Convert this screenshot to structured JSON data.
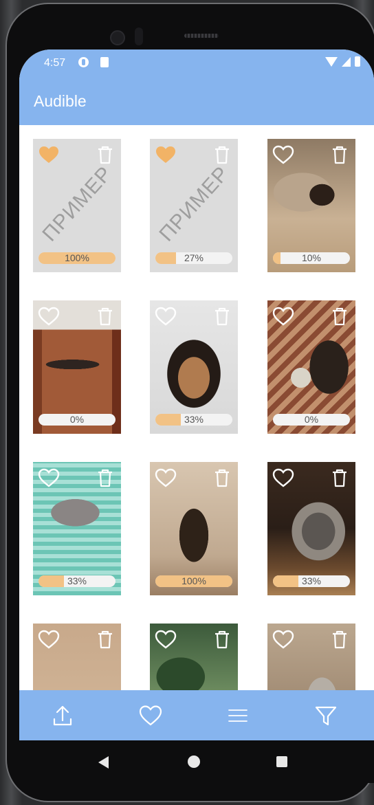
{
  "status": {
    "time": "4:57"
  },
  "app": {
    "title": "Audible"
  },
  "items": [
    {
      "placeholder": true,
      "watermark": "ПРИМЕР",
      "favorite": true,
      "progress": 100,
      "progress_label": "100%"
    },
    {
      "placeholder": true,
      "watermark": "ПРИМЕР",
      "favorite": true,
      "progress": 27,
      "progress_label": "27%"
    },
    {
      "placeholder": false,
      "favorite": false,
      "progress": 10,
      "progress_label": "10%",
      "photo": "dog-on-knitted-blanket"
    },
    {
      "placeholder": false,
      "favorite": false,
      "progress": 0,
      "progress_label": "0%",
      "photo": "dog-on-floor"
    },
    {
      "placeholder": false,
      "favorite": false,
      "progress": 33,
      "progress_label": "33%",
      "photo": "dog-portrait"
    },
    {
      "placeholder": false,
      "favorite": false,
      "progress": 0,
      "progress_label": "0%",
      "photo": "dog-with-yarn-ball"
    },
    {
      "placeholder": false,
      "favorite": false,
      "progress": 33,
      "progress_label": "33%",
      "photo": "cat-on-knitted-cushion"
    },
    {
      "placeholder": false,
      "favorite": false,
      "progress": 100,
      "progress_label": "100%",
      "photo": "kitten-sitting"
    },
    {
      "placeholder": false,
      "favorite": false,
      "progress": 33,
      "progress_label": "33%",
      "photo": "cat-in-tunnel"
    },
    {
      "placeholder": false,
      "favorite": false,
      "progress": null,
      "progress_label": "",
      "photo": "tortoiseshell-cat"
    },
    {
      "placeholder": false,
      "favorite": false,
      "progress": null,
      "progress_label": "",
      "photo": "plant-and-cat"
    },
    {
      "placeholder": false,
      "favorite": false,
      "progress": null,
      "progress_label": "",
      "photo": "cat-by-tree"
    }
  ],
  "bottom_nav": [
    "upload-icon",
    "heart-icon",
    "menu-icon",
    "filter-icon"
  ],
  "colors": {
    "accent": "#86b4ee",
    "progress": "#f2c285",
    "favorite": "#f2b366",
    "placeholder": "#dcdcdc"
  }
}
